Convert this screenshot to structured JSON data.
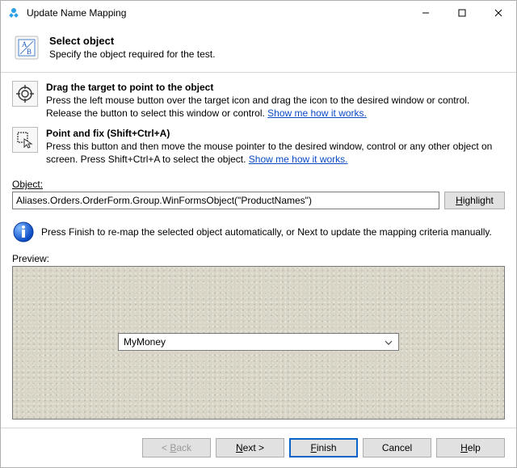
{
  "window": {
    "title": "Update Name Mapping"
  },
  "header": {
    "title": "Select object",
    "subtitle": "Specify the object required for the test."
  },
  "methods": {
    "drag": {
      "title": "Drag the target to point to the object",
      "desc": "Press the left mouse button over the target icon and drag the icon to the desired window or control. Release the button to select this window or control. ",
      "link": "Show me how it works."
    },
    "point": {
      "title": "Point and fix (Shift+Ctrl+A)",
      "desc": "Press this button and then move the mouse pointer to the desired window, control or any other object on screen. Press Shift+Ctrl+A to select the object. ",
      "link": "Show me how it works."
    }
  },
  "object": {
    "label": "Object:",
    "value": "Aliases.Orders.OrderForm.Group.WinFormsObject(\"ProductNames\")",
    "highlight": "Highlight"
  },
  "info": {
    "text": "Press Finish to re-map the selected object automatically, or Next to update the mapping criteria manually."
  },
  "preview": {
    "label": "Preview:",
    "dropdown_value": "MyMoney"
  },
  "footer": {
    "back": "< Back",
    "next": "Next >",
    "finish": "Finish",
    "cancel": "Cancel",
    "help": "Help"
  }
}
